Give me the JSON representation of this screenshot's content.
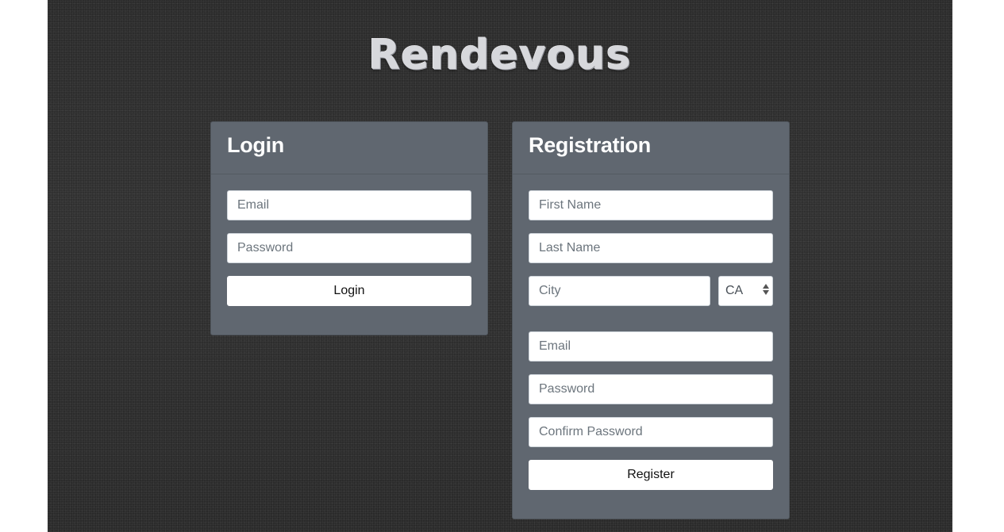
{
  "brand": {
    "title": "Rendevous"
  },
  "login": {
    "title": "Login",
    "email_placeholder": "Email",
    "password_placeholder": "Password",
    "submit_label": "Login"
  },
  "registration": {
    "title": "Registration",
    "first_name_placeholder": "First Name",
    "last_name_placeholder": "Last Name",
    "city_placeholder": "City",
    "state_selected": "CA",
    "email_placeholder": "Email",
    "password_placeholder": "Password",
    "confirm_password_placeholder": "Confirm Password",
    "submit_label": "Register"
  },
  "colors": {
    "background": "#2c2c2c",
    "card": "#606770",
    "button": "#ffffff"
  },
  "icons": {
    "state_select_arrows": "chevron-up-down-icon"
  }
}
